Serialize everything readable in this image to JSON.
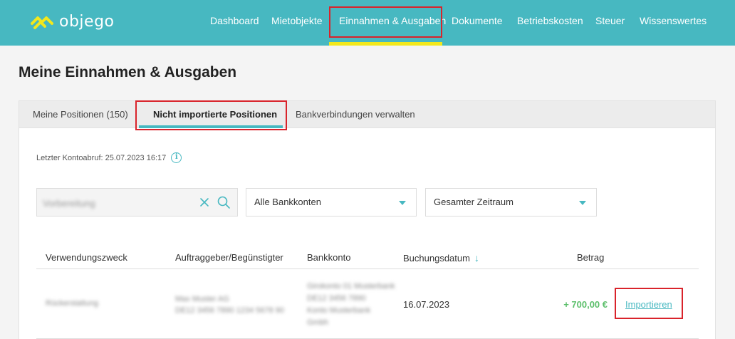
{
  "app": {
    "logo_text": "objego",
    "brand_color": "#47b8c1",
    "accent_color": "#f3e81c"
  },
  "nav": {
    "items": [
      {
        "label": "Dashboard"
      },
      {
        "label": "Mietobjekte"
      },
      {
        "label": "Einnahmen & Ausgaben",
        "active": true
      },
      {
        "label": "Dokumente"
      },
      {
        "label": "Betriebskosten"
      },
      {
        "label": "Steuer"
      },
      {
        "label": "Wissenswertes"
      }
    ]
  },
  "page": {
    "title": "Meine Einnahmen & Ausgaben"
  },
  "tabs": [
    {
      "label": "Meine Positionen (150)"
    },
    {
      "label": "Nicht importierte Positionen",
      "active": true
    },
    {
      "label": "Bankverbindungen verwalten"
    }
  ],
  "last_fetch": "Letzter Kontoabruf: 25.07.2023 16:17",
  "filters": {
    "search_value": "Vorbereitung",
    "bank_select": "Alle Bankkonten",
    "period_select": "Gesamter Zeitraum"
  },
  "table": {
    "headers": {
      "purpose": "Verwendungszweck",
      "party": "Auftraggeber/Begünstigter",
      "account": "Bankkonto",
      "date": "Buchungsdatum",
      "amount": "Betrag"
    },
    "rows": [
      {
        "purpose": "Rückerstattung",
        "party_line1": "Max Muster AG",
        "party_line2": "DE12 3456 7890 1234 5678 90",
        "account_line1": "Girokonto 01 Musterbank",
        "account_line2": "DE12 3456 7890",
        "account_line3": "Konto Musterbank",
        "account_line4": "Gmbh",
        "date": "16.07.2023",
        "amount": "+ 700,00 €",
        "action": "Importieren"
      }
    ]
  }
}
